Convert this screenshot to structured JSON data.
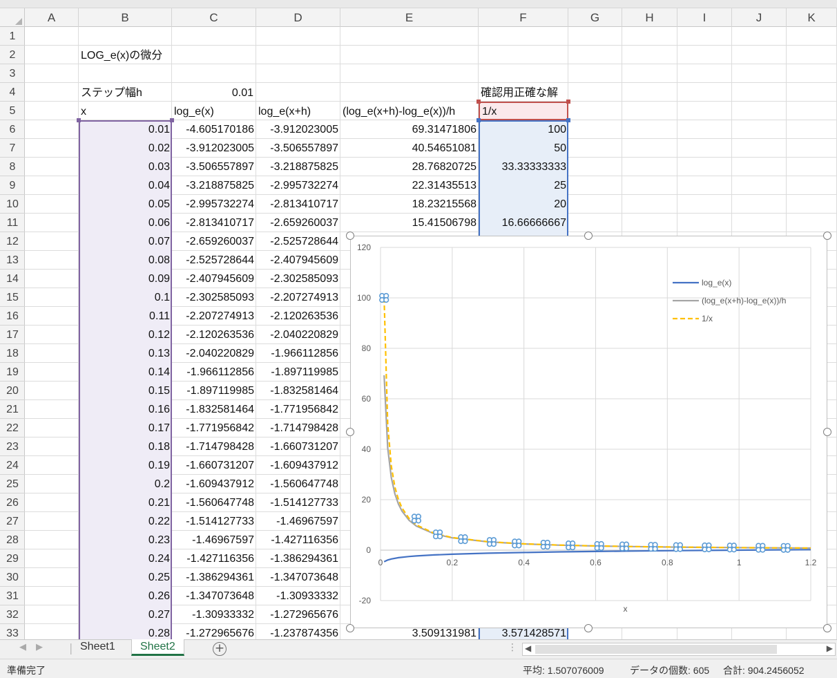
{
  "columns": [
    "A",
    "B",
    "C",
    "D",
    "E",
    "F",
    "G",
    "H",
    "I",
    "J",
    "K"
  ],
  "rows": [
    "1",
    "2",
    "3",
    "4",
    "5",
    "6",
    "7",
    "8",
    "9",
    "10",
    "11",
    "12",
    "13",
    "14",
    "15",
    "16",
    "17",
    "18",
    "19",
    "20",
    "21",
    "22",
    "23",
    "24",
    "25",
    "26",
    "27",
    "28",
    "29",
    "30",
    "31",
    "32",
    "33"
  ],
  "sheet": {
    "title": "LOG_e(x)の微分",
    "step_label": "ステップ幅h",
    "step_value": "0.01",
    "check_label": "確認用正確な解",
    "headers": {
      "x": "x",
      "log": "log_e(x)",
      "logh": "log_e(x+h)",
      "diff": "(log_e(x+h)-log_e(x))/h",
      "inv": "1/x"
    },
    "col_b": [
      "0.01",
      "0.02",
      "0.03",
      "0.04",
      "0.05",
      "0.06",
      "0.07",
      "0.08",
      "0.09",
      "0.1",
      "0.11",
      "0.12",
      "0.13",
      "0.14",
      "0.15",
      "0.16",
      "0.17",
      "0.18",
      "0.19",
      "0.2",
      "0.21",
      "0.22",
      "0.23",
      "0.24",
      "0.25",
      "0.26",
      "0.27",
      "0.28"
    ],
    "col_c": [
      "-4.605170186",
      "-3.912023005",
      "-3.506557897",
      "-3.218875825",
      "-2.995732274",
      "-2.813410717",
      "-2.659260037",
      "-2.525728644",
      "-2.407945609",
      "-2.302585093",
      "-2.207274913",
      "-2.120263536",
      "-2.040220829",
      "-1.966112856",
      "-1.897119985",
      "-1.832581464",
      "-1.771956842",
      "-1.714798428",
      "-1.660731207",
      "-1.609437912",
      "-1.560647748",
      "-1.514127733",
      "-1.46967597",
      "-1.427116356",
      "-1.386294361",
      "-1.347073648",
      "-1.30933332",
      "-1.272965676"
    ],
    "col_d": [
      "-3.912023005",
      "-3.506557897",
      "-3.218875825",
      "-2.995732274",
      "-2.813410717",
      "-2.659260037",
      "-2.525728644",
      "-2.407945609",
      "-2.302585093",
      "-2.207274913",
      "-2.120263536",
      "-2.040220829",
      "-1.966112856",
      "-1.897119985",
      "-1.832581464",
      "-1.771956842",
      "-1.714798428",
      "-1.660731207",
      "-1.609437912",
      "-1.560647748",
      "-1.514127733",
      "-1.46967597",
      "-1.427116356",
      "-1.386294361",
      "-1.347073648",
      "-1.30933332",
      "-1.272965676",
      "-1.237874356"
    ],
    "col_e": [
      "69.31471806",
      "40.54651081",
      "28.76820725",
      "22.31435513",
      "18.23215568",
      "15.41506798",
      "3.509131981"
    ],
    "col_f": [
      "100",
      "50",
      "33.33333333",
      "25",
      "20",
      "16.66666667",
      "3.571428571"
    ]
  },
  "chart_data": {
    "type": "line",
    "title": "",
    "xlabel": "x",
    "ylabel": "",
    "xlim": [
      0,
      1.2
    ],
    "ylim": [
      -20,
      120
    ],
    "xticks": [
      "0",
      "0.2",
      "0.4",
      "0.6",
      "0.8",
      "1",
      "1.2"
    ],
    "yticks": [
      "-20",
      "0",
      "20",
      "40",
      "60",
      "80",
      "100",
      "120"
    ],
    "grid": true,
    "legend_position": "top-right",
    "series": [
      {
        "name": "log_e(x)",
        "color": "#4472c4",
        "style": "solid",
        "x": [
          0.01,
          0.02,
          0.03,
          0.05,
          0.08,
          0.1,
          0.15,
          0.2,
          0.3,
          0.4,
          0.5,
          0.6,
          0.7,
          0.8,
          0.9,
          1.0,
          1.1,
          1.2
        ],
        "y": [
          -4.61,
          -3.91,
          -3.51,
          -3.0,
          -2.53,
          -2.3,
          -1.9,
          -1.61,
          -1.2,
          -0.92,
          -0.69,
          -0.51,
          -0.36,
          -0.22,
          -0.11,
          0,
          0.1,
          0.18
        ]
      },
      {
        "name": "(log_e(x+h)-log_e(x))/h",
        "color": "#a5a5a5",
        "style": "solid",
        "x": [
          0.01,
          0.02,
          0.03,
          0.04,
          0.05,
          0.06,
          0.08,
          0.1,
          0.15,
          0.2,
          0.3,
          0.4,
          0.5,
          0.6,
          0.7,
          0.8,
          0.9,
          1.0,
          1.1,
          1.2
        ],
        "y": [
          69.31,
          40.55,
          28.77,
          22.31,
          18.23,
          15.42,
          11.78,
          9.53,
          6.45,
          4.88,
          3.28,
          2.47,
          1.98,
          1.65,
          1.42,
          1.24,
          1.1,
          1.0,
          0.9,
          0.83
        ]
      },
      {
        "name": "1/x",
        "color": "#ffc000",
        "style": "dashed",
        "x": [
          0.01,
          0.02,
          0.03,
          0.04,
          0.05,
          0.06,
          0.08,
          0.1,
          0.15,
          0.2,
          0.3,
          0.4,
          0.5,
          0.6,
          0.7,
          0.8,
          0.9,
          1.0,
          1.1,
          1.2
        ],
        "y": [
          100,
          50,
          33.33,
          25,
          20,
          16.67,
          12.5,
          10,
          6.67,
          5,
          3.33,
          2.5,
          2,
          1.67,
          1.43,
          1.25,
          1.11,
          1,
          0.91,
          0.83
        ]
      }
    ],
    "markers": {
      "color": "#5b9bd5",
      "x": [
        0.01,
        0.1,
        0.16,
        0.23,
        0.31,
        0.38,
        0.46,
        0.53,
        0.61,
        0.68,
        0.76,
        0.83,
        0.91,
        0.98,
        1.06,
        1.13
      ],
      "y": [
        100,
        12.5,
        6.25,
        4.35,
        3.23,
        2.63,
        2.17,
        1.89,
        1.64,
        1.47,
        1.32,
        1.2,
        1.1,
        1.02,
        0.94,
        0.88
      ]
    }
  },
  "tabs": {
    "sheet1": "Sheet1",
    "sheet2": "Sheet2"
  },
  "status": {
    "ready": "準備完了",
    "average": "平均: 1.507076009",
    "count": "データの個数: 605",
    "sum": "合計: 904.2456052"
  }
}
